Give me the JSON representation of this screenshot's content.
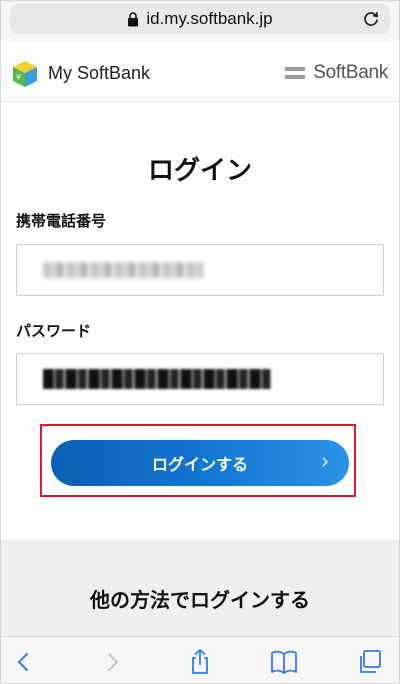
{
  "browser": {
    "url": "id.my.softbank.jp",
    "icons": [
      "lock-icon",
      "reload-icon",
      "back-icon",
      "forward-icon",
      "share-icon",
      "bookmarks-icon",
      "tabs-icon"
    ]
  },
  "header": {
    "app_name": "My SoftBank",
    "brand": "SoftBank"
  },
  "login": {
    "title": "ログイン",
    "phone_label": "携帯電話番号",
    "password_label": "パスワード",
    "submit_label": "ログインする"
  },
  "alternative": {
    "title": "他の方法でログインする"
  },
  "colors": {
    "button_start": "#0b5fb6",
    "button_end": "#2a93e6",
    "highlight": "#e0182d",
    "toolbar_icon": "#2f7bf6"
  }
}
